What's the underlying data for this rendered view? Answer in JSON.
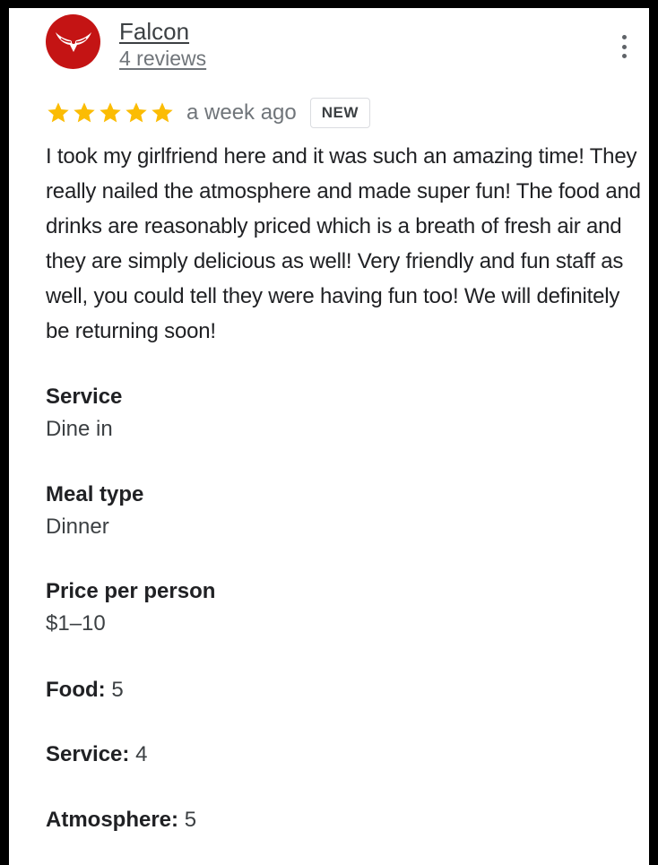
{
  "reviewer": {
    "name": "Falcon",
    "review_count": "4 reviews",
    "avatar_color": "#c41414"
  },
  "review": {
    "rating": 5,
    "rating_max": 5,
    "star_color": "#fbbc04",
    "time": "a week ago",
    "badge": "NEW",
    "text": "I took my girlfriend here and it was such an amazing time! They really nailed the atmosphere and made super fun! The food and drinks are reasonably priced which is a breath of fresh air and they are simply delicious as well! Very friendly and fun staff as well, you could tell they were having fun too! We will definitely be returning soon!"
  },
  "details": [
    {
      "label": "Service",
      "value": "Dine in"
    },
    {
      "label": "Meal type",
      "value": "Dinner"
    },
    {
      "label": "Price per person",
      "value": "$1–10"
    }
  ],
  "subratings": [
    {
      "label": "Food:",
      "value": "5"
    },
    {
      "label": "Service:",
      "value": "4"
    },
    {
      "label": "Atmosphere:",
      "value": "5"
    }
  ],
  "icons": {
    "avatar": "falcon-wings-logo-icon",
    "menu": "more-vert-icon",
    "star": "star-icon"
  }
}
